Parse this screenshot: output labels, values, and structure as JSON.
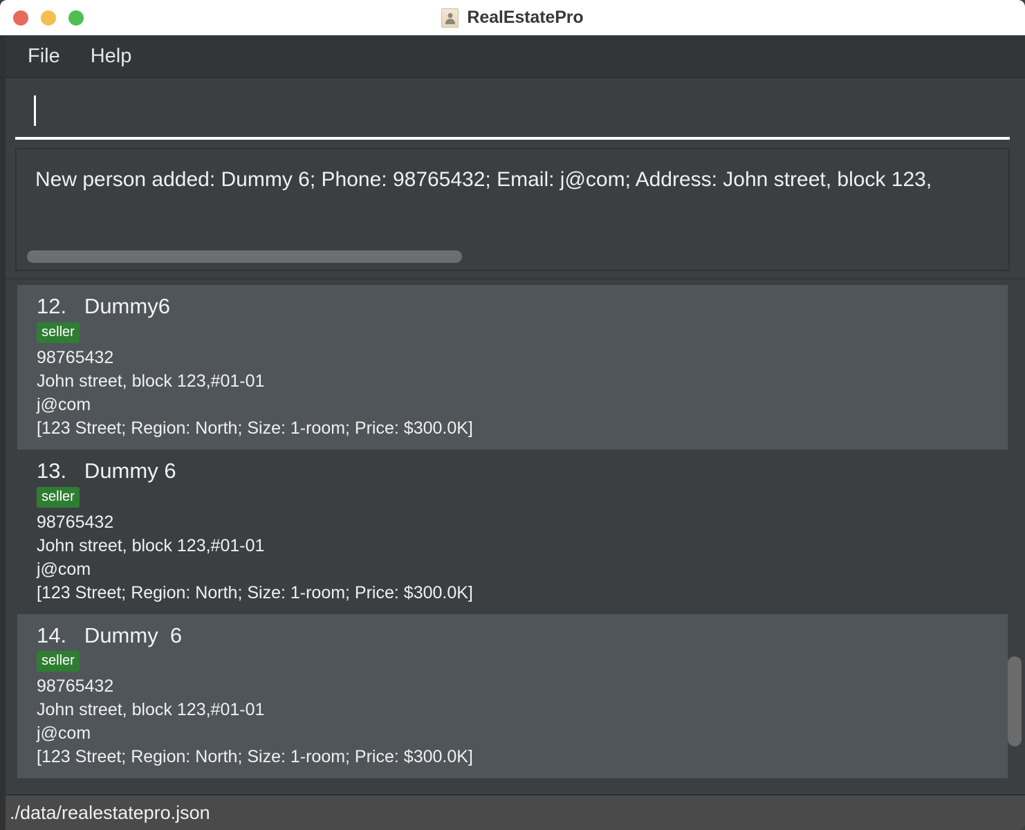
{
  "window": {
    "title": "RealEstatePro",
    "app_icon": "contact-card-icon",
    "traffic_lights": {
      "close": "close-window-button",
      "minimize": "minimize-window-button",
      "zoom": "zoom-window-button",
      "close_color": "#e8695e",
      "minimize_color": "#f5bf4f",
      "zoom_color": "#4fbf52"
    }
  },
  "menubar": {
    "items": [
      {
        "label": "File"
      },
      {
        "label": "Help"
      }
    ]
  },
  "command_input": {
    "value": "",
    "placeholder": "",
    "caret_visible": true
  },
  "result_display": {
    "text": "New person added: Dummy  6; Phone: 98765432; Email: j@com; Address: John street, block 123,",
    "horizontal_scrollbar": true
  },
  "person_list": {
    "items": [
      {
        "index": "12.",
        "name": "Dummy6",
        "header": "12.   Dummy6",
        "tags": [
          "seller"
        ],
        "phone": "98765432",
        "address": "John street, block 123,#01-01",
        "email": "j@com",
        "listing": "[123 Street; Region: North; Size: 1-room; Price: $300.0K]"
      },
      {
        "index": "13.",
        "name": "Dummy 6",
        "header": "13.   Dummy 6",
        "tags": [
          "seller"
        ],
        "phone": "98765432",
        "address": "John street, block 123,#01-01",
        "email": "j@com",
        "listing": "[123 Street; Region: North; Size: 1-room; Price: $300.0K]"
      },
      {
        "index": "14.",
        "name": "Dummy  6",
        "header": "14.   Dummy  6",
        "tags": [
          "seller"
        ],
        "phone": "98765432",
        "address": "John street, block 123,#01-01",
        "email": "j@com",
        "listing": "[123 Street; Region: North; Size: 1-room; Price: $300.0K]"
      }
    ],
    "vertical_scrollbar": true
  },
  "statusbar": {
    "path": "./data/realestatepro.json"
  },
  "colors": {
    "window_bg": "#3c3f41",
    "menubar_bg": "#333537",
    "card_odd_bg": "#50555a",
    "card_even_bg": "#3c3f41",
    "badge_seller": "#2e7d32",
    "statusbar_bg": "#4a4a4a",
    "text_primary": "#f0f0f0",
    "scrollbar_thumb": "#6e6e6e"
  }
}
